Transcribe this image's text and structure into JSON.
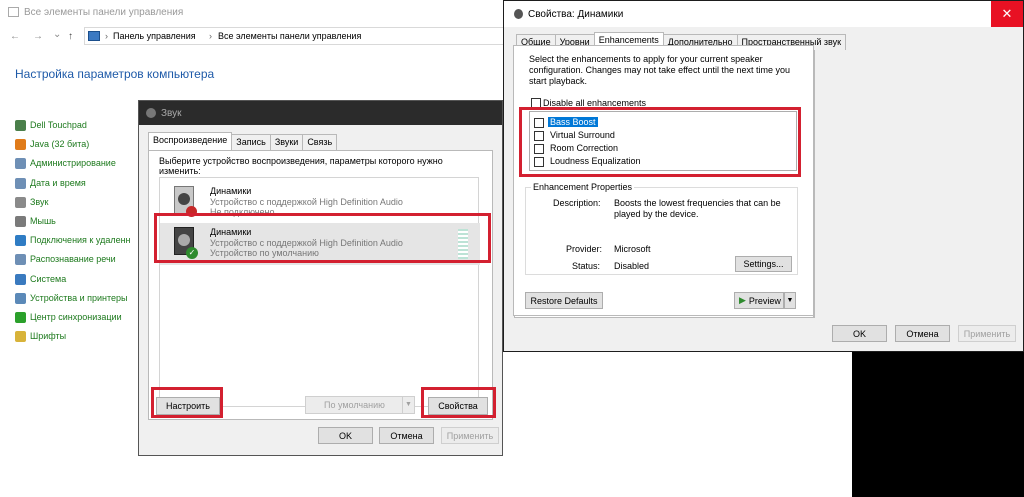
{
  "control_panel": {
    "title": "Все элементы панели управления",
    "nav": {
      "back": "←",
      "forward": "→",
      "dropdown": "⌄",
      "up": "↑"
    },
    "breadcrumb": [
      "Панель управления",
      "Все элементы панели управления"
    ],
    "heading": "Настройка параметров компьютера",
    "items": [
      {
        "label": "Dell Touchpad",
        "color": "#4a7f4a"
      },
      {
        "label": "Java (32 бита)",
        "color": "#e07b1a"
      },
      {
        "label": "Администрирование",
        "color": "#6e8fb5"
      },
      {
        "label": "Дата и время",
        "color": "#6e8fb5"
      },
      {
        "label": "Звук",
        "color": "#8a8a8a"
      },
      {
        "label": "Мышь",
        "color": "#7a7a7a"
      },
      {
        "label": "Подключения к удаленн",
        "color": "#2f7cc4"
      },
      {
        "label": "Распознавание речи",
        "color": "#6e8fb5"
      },
      {
        "label": "Система",
        "color": "#3a7abf"
      },
      {
        "label": "Устройства и принтеры",
        "color": "#5b89b8"
      },
      {
        "label": "Центр синхронизации",
        "color": "#2ba02b"
      },
      {
        "label": "Шрифты",
        "color": "#d8b33a"
      }
    ]
  },
  "sound_dialog": {
    "title": "Звук",
    "tabs": [
      "Воспроизведение",
      "Запись",
      "Звуки",
      "Связь"
    ],
    "instruction": "Выберите устройство воспроизведения, параметры которого нужно изменить:",
    "devices": [
      {
        "name": "Динамики",
        "desc": "Устройство с поддержкой High Definition Audio",
        "status": "Не подключено"
      },
      {
        "name": "Динамики",
        "desc": "Устройство с поддержкой High Definition Audio",
        "status": "Устройство по умолчанию"
      }
    ],
    "configure_button": "Настроить",
    "default_select": "По умолчанию",
    "properties_button": "Свойства",
    "ok": "OK",
    "cancel": "Отмена",
    "apply": "Применить"
  },
  "properties_dialog": {
    "title": "Свойства: Динамики",
    "close": "✕",
    "tabs": [
      "Общие",
      "Уровни",
      "Enhancements",
      "Дополнительно",
      "Пространственный звук"
    ],
    "intro": "Select the enhancements to apply for your current speaker configuration. Changes may not take effect until the next time you start playback.",
    "disable_all": "Disable all enhancements",
    "enhancements": [
      "Bass Boost",
      "Virtual Surround",
      "Room Correction",
      "Loudness Equalization"
    ],
    "group_title": "Enhancement Properties",
    "description_label": "Description:",
    "description_value": "Boosts the lowest frequencies that can be played by the device.",
    "provider_label": "Provider:",
    "provider_value": "Microsoft",
    "status_label": "Status:",
    "status_value": "Disabled",
    "settings_button": "Settings...",
    "restore_button": "Restore Defaults",
    "preview_button": "Preview",
    "ok": "OK",
    "cancel": "Отмена",
    "apply": "Применить"
  },
  "colors": {
    "highlight": "#d32030",
    "selection": "#0078d7",
    "link_green": "#1e7a1e",
    "heading_blue": "#1e5aa8"
  }
}
